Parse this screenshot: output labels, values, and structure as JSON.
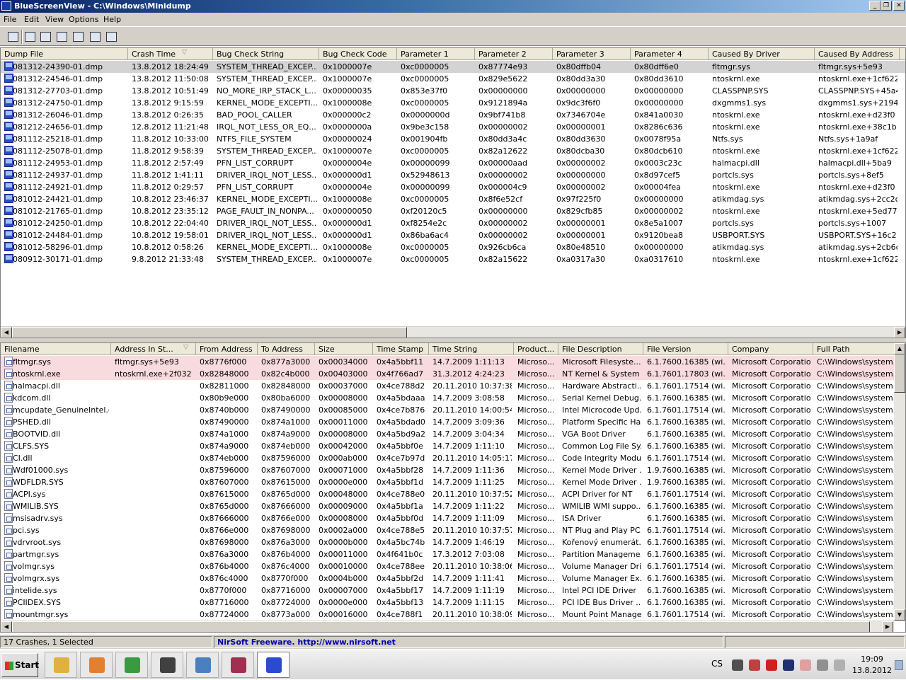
{
  "window": {
    "title": "BlueScreenView  -  C:\\Windows\\Minidump"
  },
  "menu": [
    "File",
    "Edit",
    "View",
    "Options",
    "Help"
  ],
  "toolbar": [
    "properties-icon",
    "save-icon",
    "refresh-icon",
    "copy-icon",
    "advanced-options-icon",
    "find-icon",
    "exit-icon"
  ],
  "crash_table": {
    "columns": [
      "Dump File",
      "Crash Time",
      "Bug Check String",
      "Bug Check Code",
      "Parameter 1",
      "Parameter 2",
      "Parameter 3",
      "Parameter 4",
      "Caused By Driver",
      "Caused By Address"
    ],
    "sorted_column": 1,
    "selected_row": 0,
    "rows": [
      [
        "081312-24390-01.dmp",
        "13.8.2012 18:24:49",
        "SYSTEM_THREAD_EXCEP...",
        "0x1000007e",
        "0xc0000005",
        "0x87774e93",
        "0x80dffb04",
        "0x80dff6e0",
        "fltmgr.sys",
        "fltmgr.sys+5e93"
      ],
      [
        "081312-24546-01.dmp",
        "13.8.2012 11:50:08",
        "SYSTEM_THREAD_EXCEP...",
        "0x1000007e",
        "0xc0000005",
        "0x829e5622",
        "0x80dd3a30",
        "0x80dd3610",
        "ntoskrnl.exe",
        "ntoskrnl.exe+1cf622"
      ],
      [
        "081312-27703-01.dmp",
        "13.8.2012 10:51:49",
        "NO_MORE_IRP_STACK_L...",
        "0x00000035",
        "0x853e37f0",
        "0x00000000",
        "0x00000000",
        "0x00000000",
        "CLASSPNP.SYS",
        "CLASSPNP.SYS+45a4"
      ],
      [
        "081312-24750-01.dmp",
        "13.8.2012 9:15:59",
        "KERNEL_MODE_EXCEPTI...",
        "0x1000008e",
        "0xc0000005",
        "0x9121894a",
        "0x9dc3f6f0",
        "0x00000000",
        "dxgmms1.sys",
        "dxgmms1.sys+2194a"
      ],
      [
        "081312-26046-01.dmp",
        "13.8.2012 0:26:35",
        "BAD_POOL_CALLER",
        "0x000000c2",
        "0x0000000d",
        "0x9bf741b8",
        "0x7346704e",
        "0x841a0030",
        "ntoskrnl.exe",
        "ntoskrnl.exe+d23f0"
      ],
      [
        "081212-24656-01.dmp",
        "12.8.2012 11:21:48",
        "IRQL_NOT_LESS_OR_EQ...",
        "0x0000000a",
        "0x9be3c158",
        "0x00000002",
        "0x00000001",
        "0x8286c636",
        "ntoskrnl.exe",
        "ntoskrnl.exe+38c1b"
      ],
      [
        "081112-25218-01.dmp",
        "11.8.2012 10:33:00",
        "NTFS_FILE_SYSTEM",
        "0x00000024",
        "0x001904fb",
        "0x80dd3a4c",
        "0x80dd3630",
        "0x0078f95a",
        "Ntfs.sys",
        "Ntfs.sys+1a9af"
      ],
      [
        "081112-25078-01.dmp",
        "11.8.2012 9:58:39",
        "SYSTEM_THREAD_EXCEP...",
        "0x1000007e",
        "0xc0000005",
        "0x82a12622",
        "0x80dcba30",
        "0x80dcb610",
        "ntoskrnl.exe",
        "ntoskrnl.exe+1cf622"
      ],
      [
        "081112-24953-01.dmp",
        "11.8.2012 2:57:49",
        "PFN_LIST_CORRUPT",
        "0x0000004e",
        "0x00000099",
        "0x00000aad",
        "0x00000002",
        "0x0003c23c",
        "halmacpi.dll",
        "halmacpi.dll+5ba9"
      ],
      [
        "081112-24937-01.dmp",
        "11.8.2012 1:41:11",
        "DRIVER_IRQL_NOT_LESS...",
        "0x000000d1",
        "0x52948613",
        "0x00000002",
        "0x00000000",
        "0x8d97cef5",
        "portcls.sys",
        "portcls.sys+8ef5"
      ],
      [
        "081112-24921-01.dmp",
        "11.8.2012 0:29:57",
        "PFN_LIST_CORRUPT",
        "0x0000004e",
        "0x00000099",
        "0x000004c9",
        "0x00000002",
        "0x00004fea",
        "ntoskrnl.exe",
        "ntoskrnl.exe+d23f0"
      ],
      [
        "081012-24421-01.dmp",
        "10.8.2012 23:46:37",
        "KERNEL_MODE_EXCEPTI...",
        "0x1000008e",
        "0xc0000005",
        "0x8f6e52cf",
        "0x97f225f0",
        "0x00000000",
        "atikmdag.sys",
        "atikmdag.sys+2cc2cf"
      ],
      [
        "081012-21765-01.dmp",
        "10.8.2012 23:35:12",
        "PAGE_FAULT_IN_NONPA...",
        "0x00000050",
        "0xf20120c5",
        "0x00000000",
        "0x829cfb85",
        "0x00000002",
        "ntoskrnl.exe",
        "ntoskrnl.exe+5ed77"
      ],
      [
        "081012-24250-01.dmp",
        "10.8.2012 22:04:40",
        "DRIVER_IRQL_NOT_LESS...",
        "0x000000d1",
        "0xf8254e2c",
        "0x00000002",
        "0x00000001",
        "0x8e5a1007",
        "portcls.sys",
        "portcls.sys+1007"
      ],
      [
        "081012-24484-01.dmp",
        "10.8.2012 19:58:01",
        "DRIVER_IRQL_NOT_LESS...",
        "0x000000d1",
        "0x86ba6ac4",
        "0x00000002",
        "0x00000001",
        "0x9120bea8",
        "USBPORT.SYS",
        "USBPORT.SYS+16c2"
      ],
      [
        "081012-58296-01.dmp",
        "10.8.2012 0:58:26",
        "KERNEL_MODE_EXCEPTI...",
        "0x1000008e",
        "0xc0000005",
        "0x926cb6ca",
        "0x80e48510",
        "0x00000000",
        "atikmdag.sys",
        "atikmdag.sys+2cb6ca"
      ],
      [
        "080912-30171-01.dmp",
        "9.8.2012 21:33:48",
        "SYSTEM_THREAD_EXCEP...",
        "0x1000007e",
        "0xc0000005",
        "0x82a15622",
        "0xa0317a30",
        "0xa0317610",
        "ntoskrnl.exe",
        "ntoskrnl.exe+1cf622"
      ]
    ]
  },
  "driver_table": {
    "columns": [
      "Filename",
      "Address In St...",
      "From Address",
      "To Address",
      "Size",
      "Time Stamp",
      "Time String",
      "Product...",
      "File Description",
      "File Version",
      "Company",
      "Full Path"
    ],
    "sorted_column": 1,
    "highlighted_rows": [
      0,
      1
    ],
    "rows": [
      [
        "fltmgr.sys",
        "fltmgr.sys+5e93",
        "0x8776f000",
        "0x877a3000",
        "0x00034000",
        "0x4a5bbf11",
        "14.7.2009 1:11:13",
        "Microso...",
        "Microsoft Filesyste...",
        "6.1.7600.16385 (wi...",
        "Microsoft Corporation",
        "C:\\Windows\\system..."
      ],
      [
        "ntoskrnl.exe",
        "ntoskrnl.exe+2f032",
        "0x82848000",
        "0x82c4b000",
        "0x00403000",
        "0x4f766ad7",
        "31.3.2012 4:24:23",
        "Microso...",
        "NT Kernel & System",
        "6.1.7601.17803 (wi...",
        "Microsoft Corporation",
        "C:\\Windows\\system..."
      ],
      [
        "halmacpi.dll",
        "",
        "0x82811000",
        "0x82848000",
        "0x00037000",
        "0x4ce788d2",
        "20.11.2010 10:37:38",
        "Microso...",
        "Hardware Abstracti...",
        "6.1.7601.17514 (wi...",
        "Microsoft Corporation",
        "C:\\Windows\\system..."
      ],
      [
        "kdcom.dll",
        "",
        "0x80b9e000",
        "0x80ba6000",
        "0x00008000",
        "0x4a5bdaaa",
        "14.7.2009 3:08:58",
        "Microso...",
        "Serial Kernel Debug...",
        "6.1.7600.16385 (wi...",
        "Microsoft Corporation",
        "C:\\Windows\\system..."
      ],
      [
        "mcupdate_GenuineIntel.dll",
        "",
        "0x8740b000",
        "0x87490000",
        "0x00085000",
        "0x4ce7b876",
        "20.11.2010 14:00:54",
        "Microso...",
        "Intel Microcode Upd...",
        "6.1.7601.17514 (wi...",
        "Microsoft Corporation",
        "C:\\Windows\\system..."
      ],
      [
        "PSHED.dll",
        "",
        "0x87490000",
        "0x874a1000",
        "0x00011000",
        "0x4a5bdad0",
        "14.7.2009 3:09:36",
        "Microso...",
        "Platform Specific Ha...",
        "6.1.7600.16385 (wi...",
        "Microsoft Corporation",
        "C:\\Windows\\system..."
      ],
      [
        "BOOTVID.dll",
        "",
        "0x874a1000",
        "0x874a9000",
        "0x00008000",
        "0x4a5bd9a2",
        "14.7.2009 3:04:34",
        "Microso...",
        "VGA Boot Driver",
        "6.1.7600.16385 (wi...",
        "Microsoft Corporation",
        "C:\\Windows\\system..."
      ],
      [
        "CLFS.SYS",
        "",
        "0x874a9000",
        "0x874eb000",
        "0x00042000",
        "0x4a5bbf0e",
        "14.7.2009 1:11:10",
        "Microso...",
        "Common Log File Sy...",
        "6.1.7600.16385 (wi...",
        "Microsoft Corporation",
        "C:\\Windows\\system..."
      ],
      [
        "CI.dll",
        "",
        "0x874eb000",
        "0x87596000",
        "0x000ab000",
        "0x4ce7b97d",
        "20.11.2010 14:05:17",
        "Microso...",
        "Code Integrity Module",
        "6.1.7601.17514 (wi...",
        "Microsoft Corporation",
        "C:\\Windows\\system..."
      ],
      [
        "Wdf01000.sys",
        "",
        "0x87596000",
        "0x87607000",
        "0x00071000",
        "0x4a5bbf28",
        "14.7.2009 1:11:36",
        "Microso...",
        "Kernel Mode Driver ...",
        "1.9.7600.16385 (wi...",
        "Microsoft Corporation",
        "C:\\Windows\\system..."
      ],
      [
        "WDFLDR.SYS",
        "",
        "0x87607000",
        "0x87615000",
        "0x0000e000",
        "0x4a5bbf1d",
        "14.7.2009 1:11:25",
        "Microso...",
        "Kernel Mode Driver ...",
        "1.9.7600.16385 (wi...",
        "Microsoft Corporation",
        "C:\\Windows\\system..."
      ],
      [
        "ACPI.sys",
        "",
        "0x87615000",
        "0x8765d000",
        "0x00048000",
        "0x4ce788e0",
        "20.11.2010 10:37:52",
        "Microso...",
        "ACPI Driver for NT",
        "6.1.7601.17514 (wi...",
        "Microsoft Corporation",
        "C:\\Windows\\system..."
      ],
      [
        "WMILIB.SYS",
        "",
        "0x8765d000",
        "0x87666000",
        "0x00009000",
        "0x4a5bbf1a",
        "14.7.2009 1:11:22",
        "Microso...",
        "WMILIB WMI suppo...",
        "6.1.7600.16385 (wi...",
        "Microsoft Corporation",
        "C:\\Windows\\system..."
      ],
      [
        "msisadrv.sys",
        "",
        "0x87666000",
        "0x8766e000",
        "0x00008000",
        "0x4a5bbf0d",
        "14.7.2009 1:11:09",
        "Microso...",
        "ISA Driver",
        "6.1.7600.16385 (wi...",
        "Microsoft Corporation",
        "C:\\Windows\\system..."
      ],
      [
        "pci.sys",
        "",
        "0x8766e000",
        "0x87698000",
        "0x0002a000",
        "0x4ce788e5",
        "20.11.2010 10:37:57",
        "Microso...",
        "NT Plug and Play PC...",
        "6.1.7601.17514 (wi...",
        "Microsoft Corporation",
        "C:\\Windows\\system..."
      ],
      [
        "vdrvroot.sys",
        "",
        "0x87698000",
        "0x876a3000",
        "0x0000b000",
        "0x4a5bc74b",
        "14.7.2009 1:46:19",
        "Microso...",
        "Kořenový enumerát...",
        "6.1.7600.16385 (wi...",
        "Microsoft Corporation",
        "C:\\Windows\\system..."
      ],
      [
        "partmgr.sys",
        "",
        "0x876a3000",
        "0x876b4000",
        "0x00011000",
        "0x4f641b0c",
        "17.3.2012 7:03:08",
        "Microso...",
        "Partition Manageme...",
        "6.1.7600.16385 (wi...",
        "Microsoft Corporation",
        "C:\\Windows\\system..."
      ],
      [
        "volmgr.sys",
        "",
        "0x876b4000",
        "0x876c4000",
        "0x00010000",
        "0x4ce788ee",
        "20.11.2010 10:38:06",
        "Microso...",
        "Volume Manager Dri...",
        "6.1.7601.17514 (wi...",
        "Microsoft Corporation",
        "C:\\Windows\\system..."
      ],
      [
        "volmgrx.sys",
        "",
        "0x876c4000",
        "0x8770f000",
        "0x0004b000",
        "0x4a5bbf2d",
        "14.7.2009 1:11:41",
        "Microso...",
        "Volume Manager Ex...",
        "6.1.7600.16385 (wi...",
        "Microsoft Corporation",
        "C:\\Windows\\system..."
      ],
      [
        "intelide.sys",
        "",
        "0x8770f000",
        "0x87716000",
        "0x00007000",
        "0x4a5bbf17",
        "14.7.2009 1:11:19",
        "Microso...",
        "Intel PCI IDE Driver",
        "6.1.7600.16385 (wi...",
        "Microsoft Corporation",
        "C:\\Windows\\system..."
      ],
      [
        "PCIIDEX.SYS",
        "",
        "0x87716000",
        "0x87724000",
        "0x0000e000",
        "0x4a5bbf13",
        "14.7.2009 1:11:15",
        "Microso...",
        "PCI IDE Bus Driver ...",
        "6.1.7600.16385 (wi...",
        "Microsoft Corporation",
        "C:\\Windows\\system..."
      ],
      [
        "mountmgr.sys",
        "",
        "0x87724000",
        "0x8773a000",
        "0x00016000",
        "0x4ce788f1",
        "20.11.2010 10:38:09",
        "Microso...",
        "Mount Point Manager",
        "6.1.7601.17514 (wi...",
        "Microsoft Corporation",
        "C:\\Windows\\system..."
      ]
    ]
  },
  "status": {
    "crashes": "17 Crashes, 1 Selected",
    "credit": "NirSoft Freeware.  http://www.nirsoft.net"
  },
  "colors": {
    "credit": "#0000a0",
    "highlight_row": "#f7dbde",
    "selected_row": "#d3d3d3"
  },
  "taskbar": {
    "start_label": "Start",
    "apps": [
      {
        "name": "explorer-icon",
        "color": "#e0b040"
      },
      {
        "name": "media-player-icon",
        "color": "#e08030"
      },
      {
        "name": "chrome-icon",
        "color": "#3a9a40"
      },
      {
        "name": "remote-desktop-icon",
        "color": "#404040"
      },
      {
        "name": "control-panel-icon",
        "color": "#4a80c0"
      },
      {
        "name": "winrar-icon",
        "color": "#a03050"
      },
      {
        "name": "bluescreenview-icon",
        "color": "#2a4bd0"
      }
    ],
    "language": "CS",
    "clock_time": "19:09",
    "clock_date": "13.8.2012"
  }
}
